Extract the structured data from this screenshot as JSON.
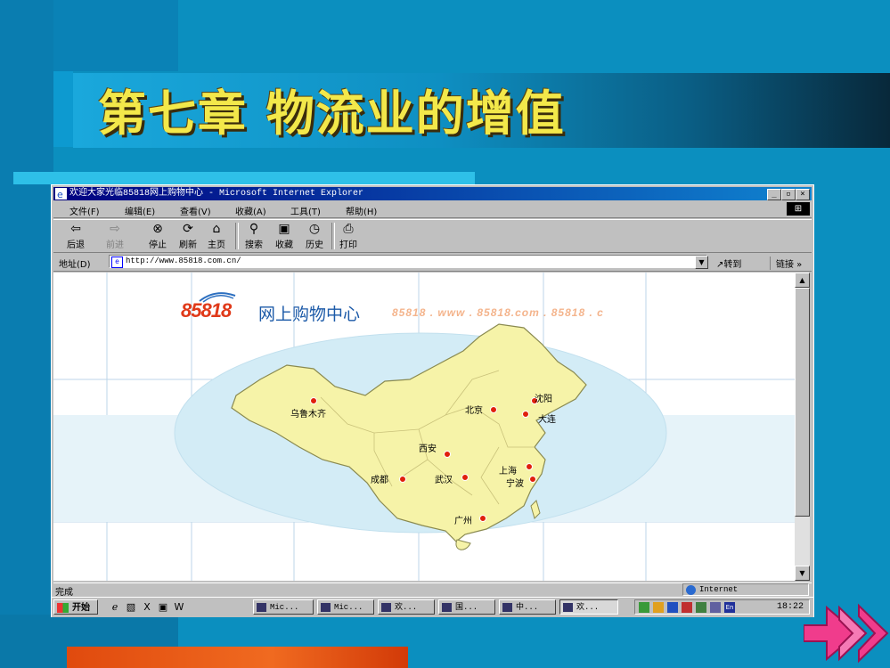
{
  "slide": {
    "title": "第七章  物流业的增值"
  },
  "browser": {
    "window_title": "欢迎大家光临85818网上购物中心 - Microsoft Internet Explorer",
    "menu": [
      "文件(F)",
      "编辑(E)",
      "查看(V)",
      "收藏(A)",
      "工具(T)",
      "帮助(H)"
    ],
    "toolbar": [
      {
        "label": "后退",
        "icon": "back-arrow-icon"
      },
      {
        "label": "前进",
        "icon": "forward-arrow-icon"
      },
      {
        "label": "停止",
        "icon": "stop-icon"
      },
      {
        "label": "刷新",
        "icon": "refresh-icon"
      },
      {
        "label": "主页",
        "icon": "home-icon"
      },
      {
        "label": "搜索",
        "icon": "search-icon"
      },
      {
        "label": "收藏",
        "icon": "favorites-icon"
      },
      {
        "label": "历史",
        "icon": "history-icon"
      },
      {
        "label": "打印",
        "icon": "print-icon"
      }
    ],
    "address_label": "地址(D)",
    "address_url": "http://www.85818.com.cn/",
    "go_label": "转到",
    "links_label": "链接 »",
    "status_text": "完成",
    "status_zone": "Internet"
  },
  "page": {
    "logo_number": "85818",
    "logo_text": "网上购物中心",
    "logo_ghost": "85818 . www . 85818.com . 85818 . c",
    "cities": [
      "乌鲁木齐",
      "北京",
      "沈阳",
      "大连",
      "西安",
      "上海",
      "宁波",
      "成都",
      "武汉",
      "广州"
    ]
  },
  "taskbar": {
    "start_label": "开始",
    "tasks": [
      "Mic...",
      "Mic...",
      "欢...",
      "国...",
      "中...",
      "欢..."
    ],
    "clock": "18:22"
  },
  "colors": {
    "slide_bg": "#0b8fbf",
    "title_text": "#f3e84a",
    "accent_orange": "#e04a0e",
    "arrow_pink": "#f03c8c",
    "map_fill": "#f6f3a8",
    "map_sea": "#d3ecf6"
  }
}
